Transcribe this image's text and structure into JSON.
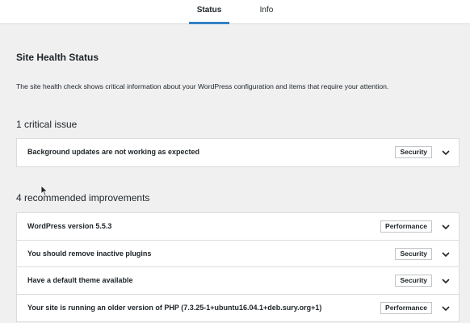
{
  "tabs": [
    {
      "label": "Status",
      "active": true
    },
    {
      "label": "Info",
      "active": false
    }
  ],
  "page_title": "Site Health Status",
  "intro": "The site health check shows critical information about your WordPress configuration and items that require your attention.",
  "critical": {
    "title": "1 critical issue",
    "items": [
      {
        "label": "Background updates are not working as expected",
        "badge": "Security"
      }
    ]
  },
  "recommended": {
    "title": "4 recommended improvements",
    "items": [
      {
        "label": "WordPress version 5.5.3",
        "badge": "Performance"
      },
      {
        "label": "You should remove inactive plugins",
        "badge": "Security"
      },
      {
        "label": "Have a default theme available",
        "badge": "Security"
      },
      {
        "label": "Your site is running an older version of PHP (7.3.25-1+ubuntu16.04.1+deb.sury.org+1)",
        "badge": "Performance"
      }
    ]
  },
  "colors": {
    "accent": "#3582c4",
    "background": "#f0f0f1",
    "panel": "#ffffff",
    "border": "#dcdcde"
  },
  "icons": [
    "chevron-down-icon",
    "mouse-cursor-icon"
  ]
}
